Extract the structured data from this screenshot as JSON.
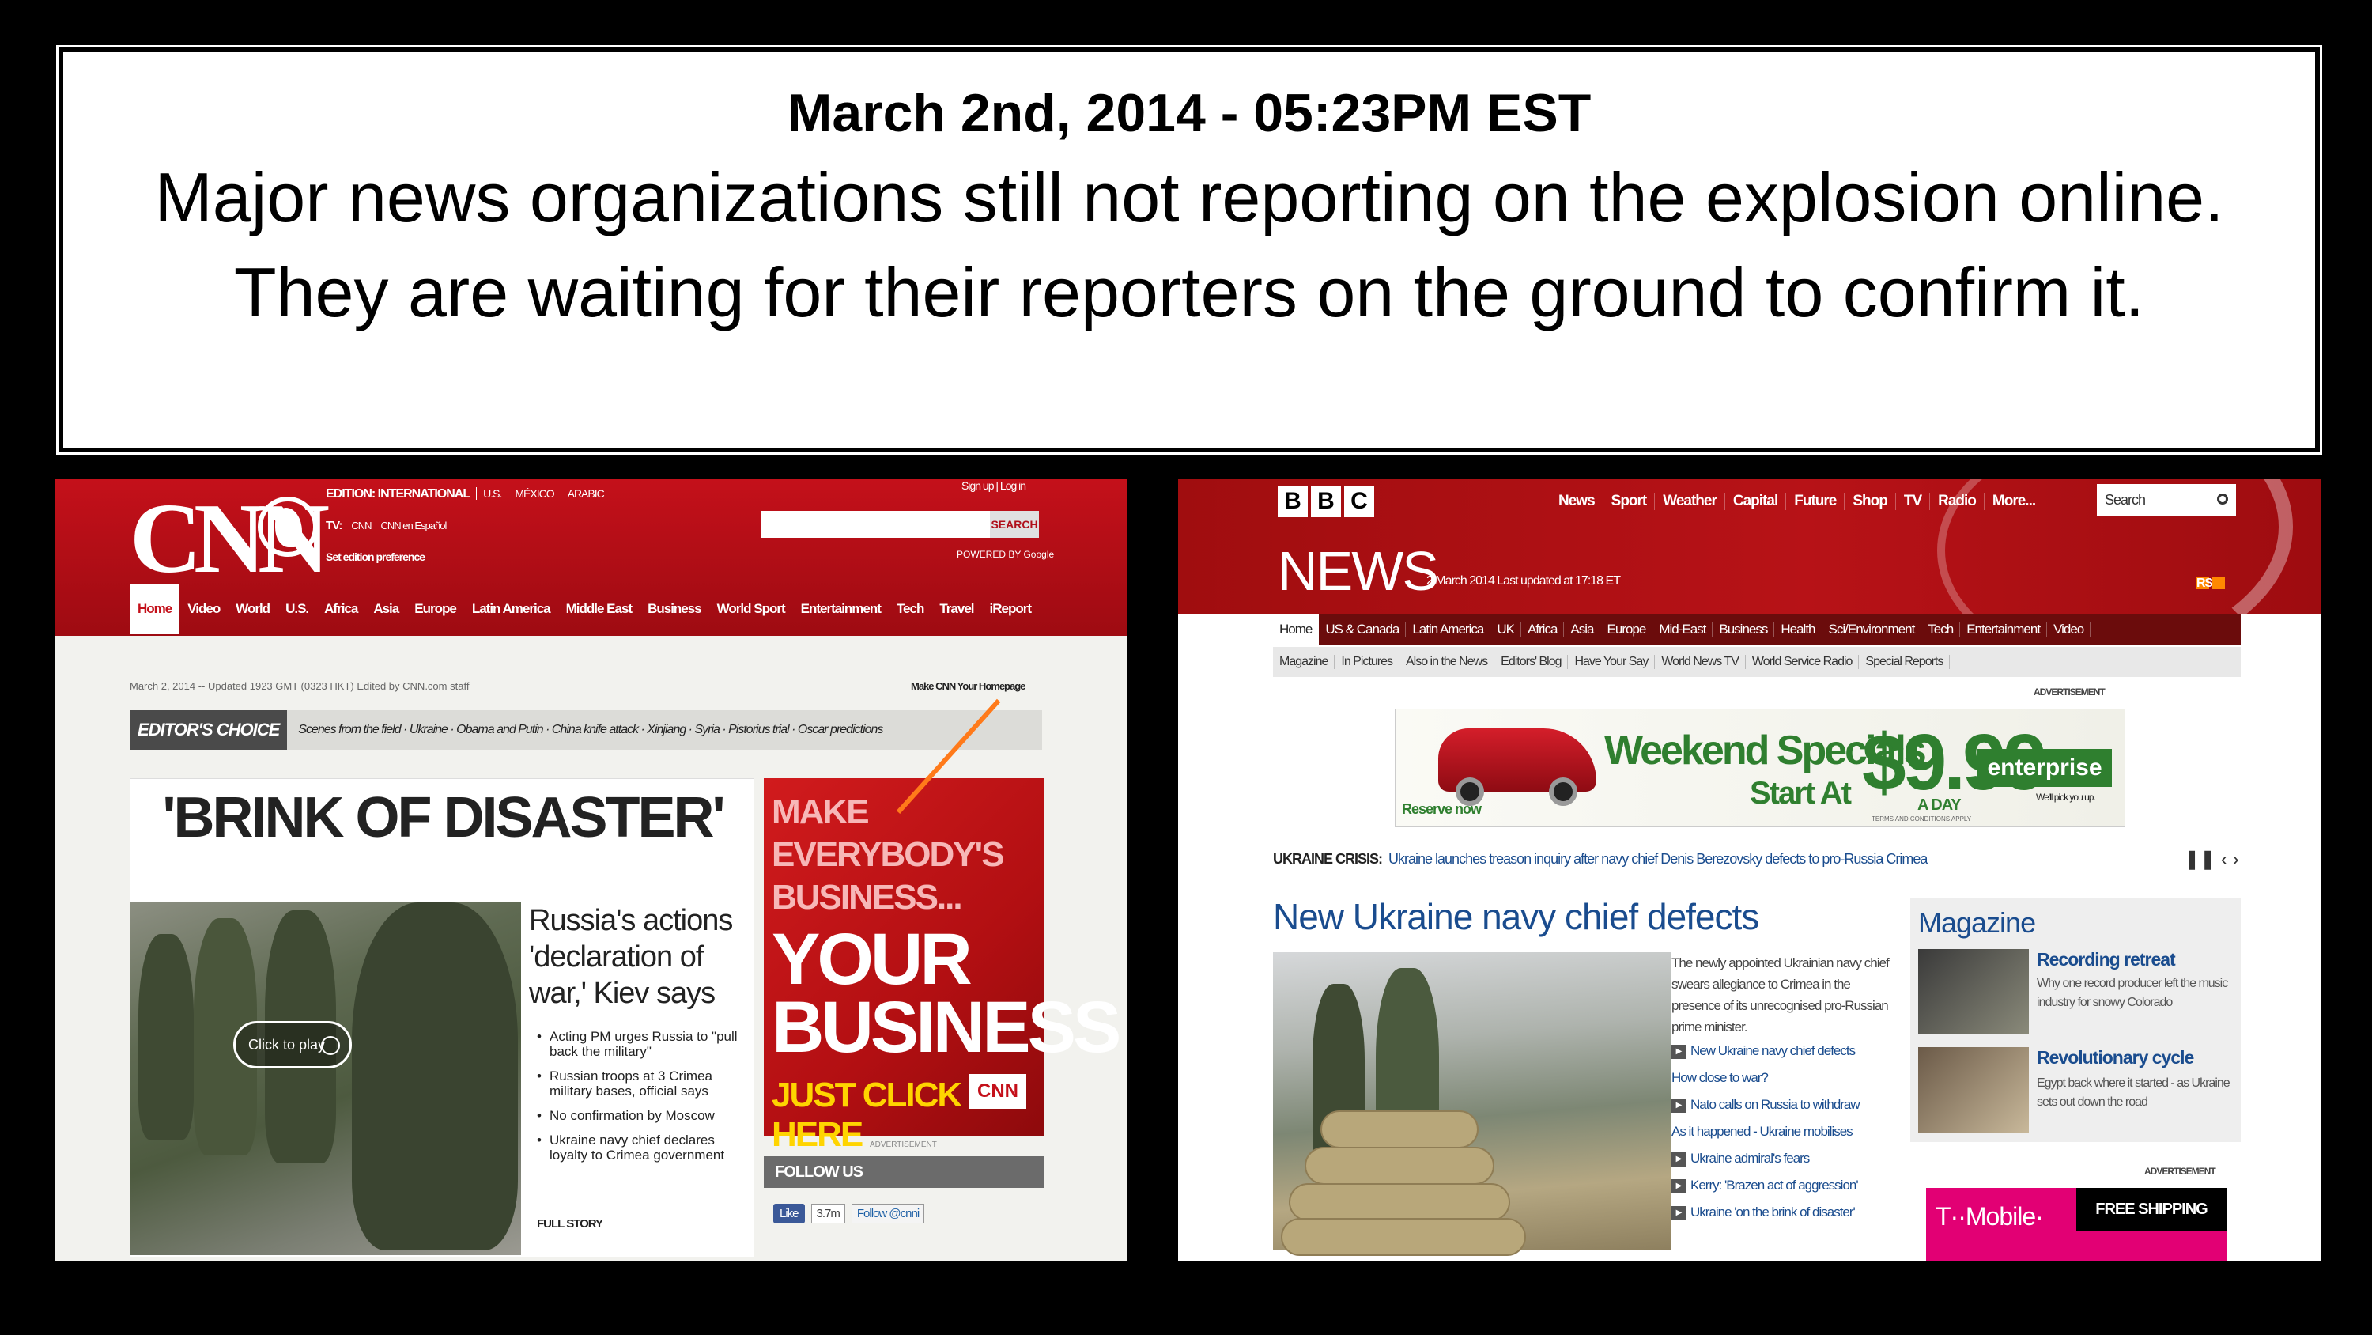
{
  "caption": {
    "date": "March 2nd, 2014 - 05:23PM EST",
    "body": "Major news organizations still not reporting on the explosion online. They are waiting for their reporters on the ground to confirm it."
  },
  "cnn": {
    "logo": "CNN",
    "edition": "EDITION: INTERNATIONAL",
    "edition_links": [
      "U.S.",
      "MÉXICO",
      "ARABIC"
    ],
    "tv_label": "TV:",
    "tv_links": [
      "CNN",
      "CNN en Español"
    ],
    "set_edition": "Set edition preference",
    "signup": "Sign up",
    "login": "Log in",
    "search_button": "SEARCH",
    "powered_by": "POWERED BY Google",
    "nav": [
      "Home",
      "Video",
      "World",
      "U.S.",
      "Africa",
      "Asia",
      "Europe",
      "Latin America",
      "Middle East",
      "Business",
      "World Sport",
      "Entertainment",
      "Tech",
      "Travel",
      "iReport"
    ],
    "meta": "March 2, 2014 -- Updated 1923 GMT (0323 HKT) Edited by CNN.com staff",
    "make_homepage": "Make CNN Your Homepage",
    "editors_choice": "EDITOR'S CHOICE",
    "editors_links": "Scenes from the field · Ukraine · Obama and Putin · China knife attack · Xinjiang · Syria · Pistorius trial · Oscar predictions",
    "main_headline": "'BRINK OF DISASTER'",
    "play_label": "Click to play",
    "story_headline": "Russia's actions 'declaration of war,' Kiev says",
    "bullets": [
      "Acting PM urges Russia to \"pull back the military\"",
      "Russian troops at 3 Crimea military bases, official says",
      "No confirmation by Moscow",
      "Ukraine navy chief declares loyalty to Crimea government"
    ],
    "full_story": "FULL STORY",
    "ad": {
      "line1": "MAKE EVERYBODY'S BUSINESS...",
      "line2": "YOUR BUSINESS",
      "line3": "JUST CLICK HERE",
      "logo": "CNN"
    },
    "ad_label": "ADVERTISEMENT",
    "follow_us": "FOLLOW US",
    "fb_like": "Like",
    "fb_count": "3.7m",
    "twitter": "Follow @cnni"
  },
  "bbc": {
    "blocks": [
      "B",
      "B",
      "C"
    ],
    "top_nav": [
      "News",
      "Sport",
      "Weather",
      "Capital",
      "Future",
      "Shop",
      "TV",
      "Radio",
      "More..."
    ],
    "search_placeholder": "Search",
    "news": "NEWS",
    "date": "2 March 2014   Last updated at 17:18 ET",
    "rss": "RSS",
    "nav1": [
      "Home",
      "US & Canada",
      "Latin America",
      "UK",
      "Africa",
      "Asia",
      "Europe",
      "Mid-East",
      "Business",
      "Health",
      "Sci/Environment",
      "Tech",
      "Entertainment",
      "Video"
    ],
    "nav2": [
      "Magazine",
      "In Pictures",
      "Also in the News",
      "Editors' Blog",
      "Have Your Say",
      "World News TV",
      "World Service Radio",
      "Special Reports"
    ],
    "ad_label": "ADVERTISEMENT",
    "banner": {
      "reserve": "Reserve now",
      "weekend": "Weekend Specials",
      "start_at": "Start At",
      "price": "$9.99",
      "a_day": "A DAY",
      "brand": "enterprise",
      "tagline": "We'll pick you up.",
      "terms": "TERMS AND CONDITIONS APPLY"
    },
    "crisis_label": "UKRAINE CRISIS:",
    "crisis_text": "Ukraine launches treason inquiry after navy chief Denis Berezovsky defects to pro-Russia Crimea",
    "headline": "New Ukraine navy chief defects",
    "lead": "The newly appointed Ukrainian navy chief swears allegiance to Crimea in the presence of its unrecognised pro-Russian prime minister.",
    "links": [
      {
        "text": "New Ukraine navy chief defects",
        "video": true
      },
      {
        "text": "How close to war?",
        "video": false
      },
      {
        "text": "Nato calls on Russia to withdraw",
        "video": true
      },
      {
        "text": "As it happened - Ukraine mobilises",
        "video": false
      },
      {
        "text": "Ukraine admiral's fears",
        "video": true
      },
      {
        "text": "Kerry: 'Brazen act of aggression'",
        "video": true
      },
      {
        "text": "Ukraine 'on the brink of disaster'",
        "video": true
      }
    ],
    "magazine": {
      "title": "Magazine",
      "items": [
        {
          "headline": "Recording retreat",
          "desc": "Why one record producer left the music industry for snowy Colorado"
        },
        {
          "headline": "Revolutionary cycle",
          "desc": "Egypt back where it started - as Ukraine sets out down the road"
        }
      ]
    },
    "ad_label2": "ADVERTISEMENT",
    "tmobile": "T··Mobile·",
    "free_shipping": "FREE SHIPPING"
  }
}
